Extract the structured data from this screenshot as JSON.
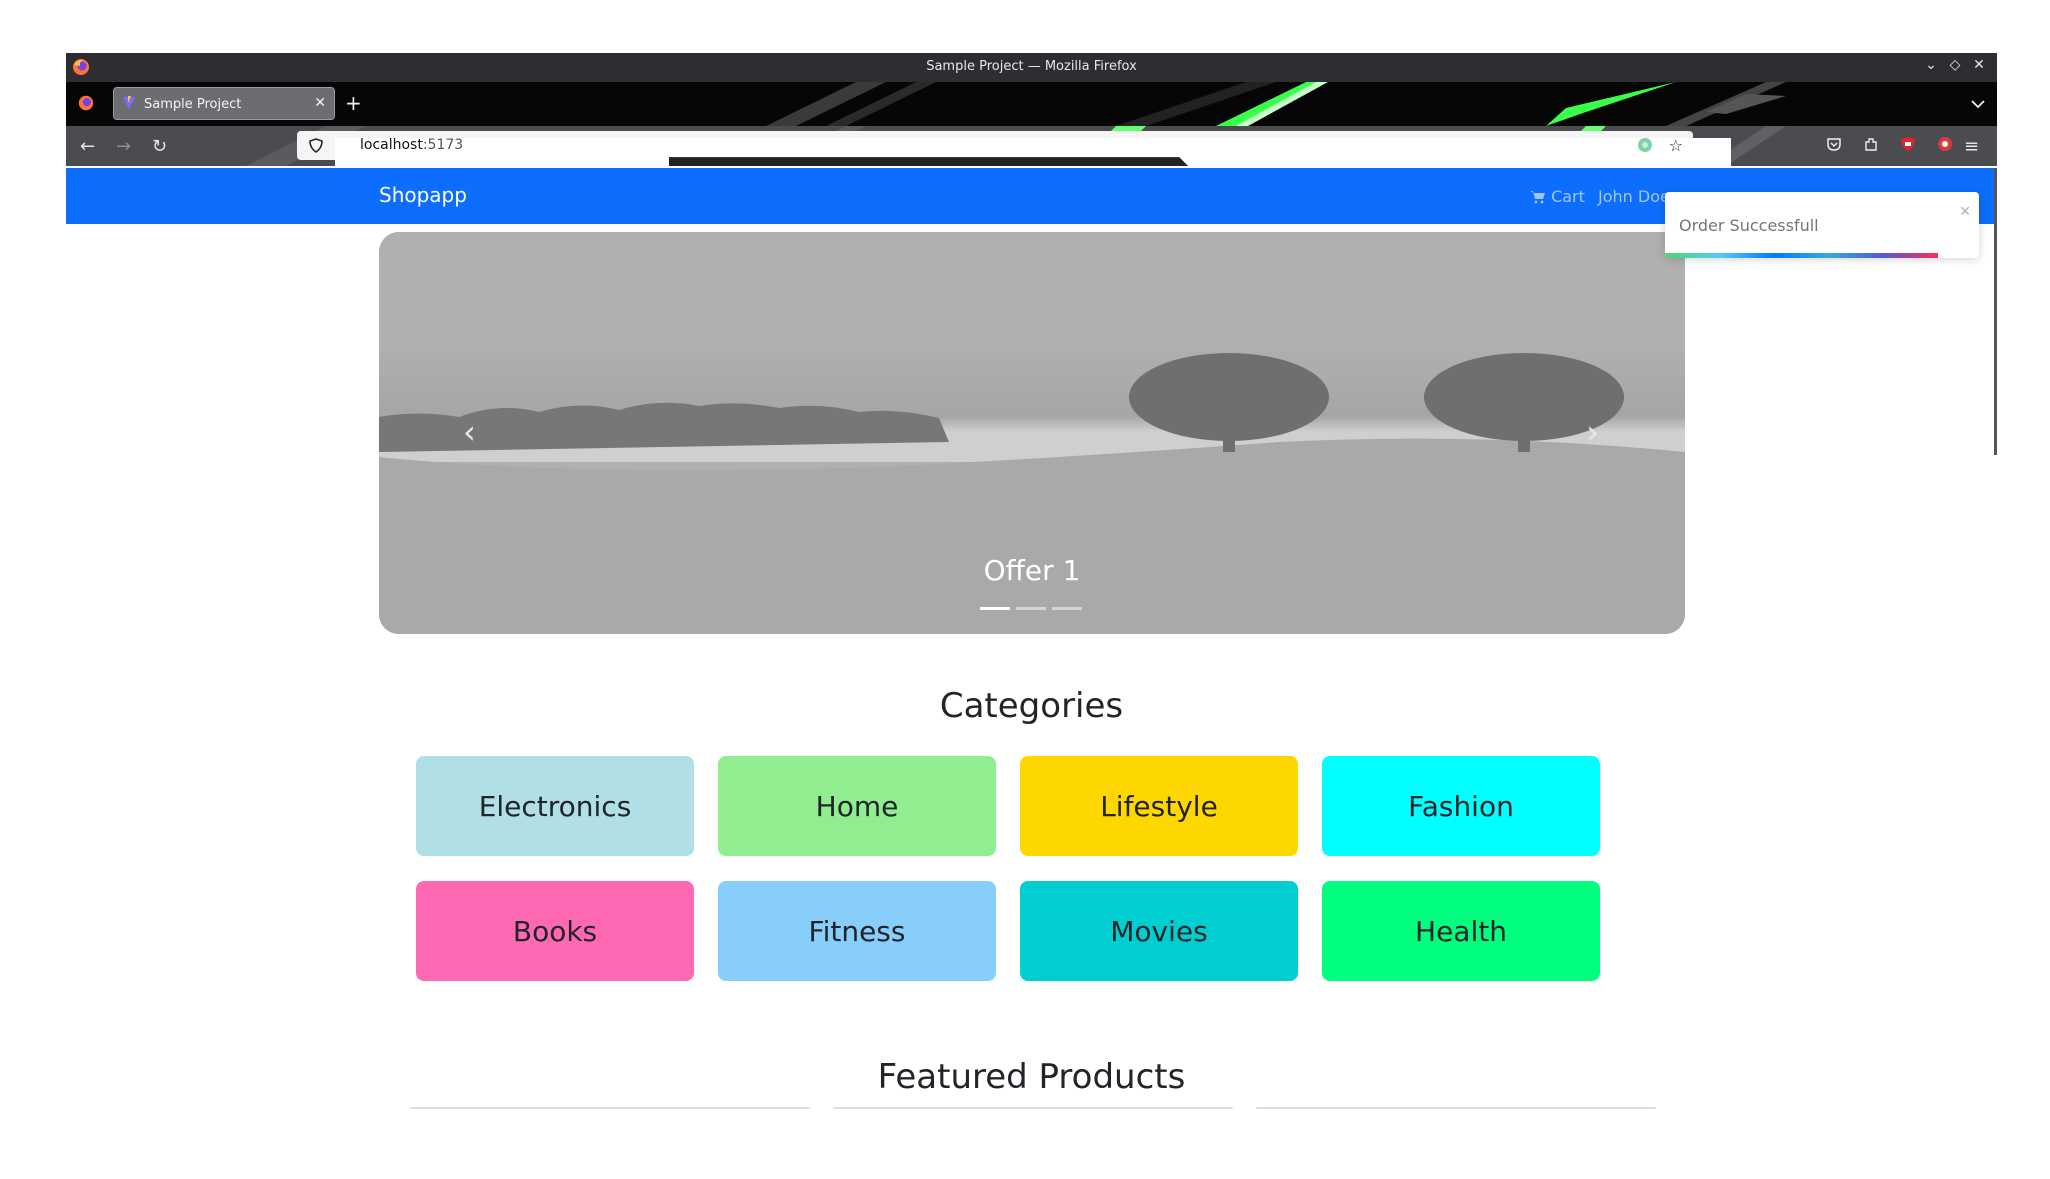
{
  "browser": {
    "window_title": "Sample Project — Mozilla Firefox",
    "tab_title": "Sample Project",
    "url_host": "localhost",
    "url_port": ":5173"
  },
  "app": {
    "brand": "Shopapp",
    "cart_label": "Cart",
    "user_name": "John Doe",
    "primary_color": "#0d6efd"
  },
  "carousel": {
    "caption": "Offer 1",
    "slide_count": 3,
    "active_index": 0
  },
  "categories": {
    "title": "Categories",
    "items": [
      {
        "label": "Electronics",
        "color": "#b0dfe5"
      },
      {
        "label": "Home",
        "color": "#90ee90"
      },
      {
        "label": "Lifestyle",
        "color": "#ffd700"
      },
      {
        "label": "Fashion",
        "color": "#00ffff"
      },
      {
        "label": "Books",
        "color": "#ff69b4"
      },
      {
        "label": "Fitness",
        "color": "#87cefa"
      },
      {
        "label": "Movies",
        "color": "#00ced1"
      },
      {
        "label": "Health",
        "color": "#00ff7f"
      }
    ]
  },
  "featured": {
    "title": "Featured Products"
  },
  "toast": {
    "message": "Order Successfull",
    "progress": 0.87
  }
}
